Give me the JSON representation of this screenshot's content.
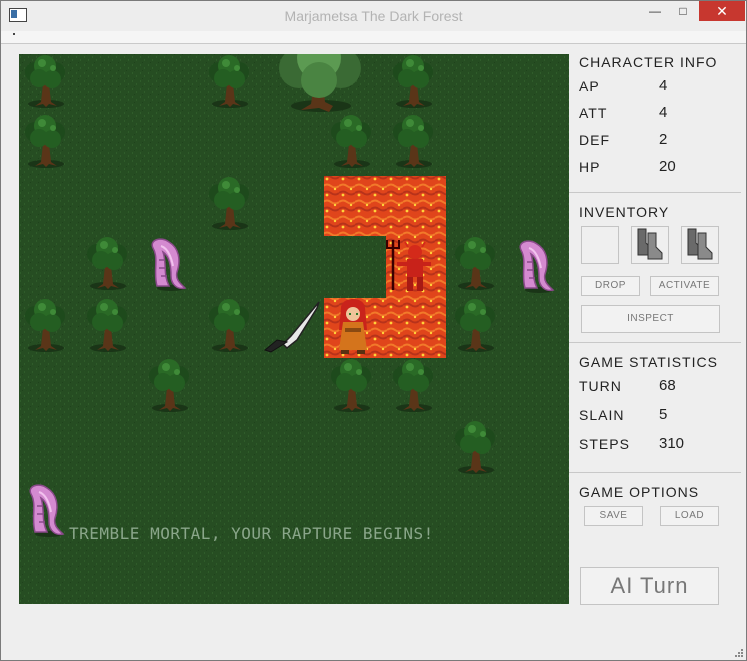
{
  "window": {
    "title": "Marjametsa The Dark Forest"
  },
  "board": {
    "message": "TREMBLE MORTAL, YOUR RAPTURE BEGINS!"
  },
  "character_info": {
    "title": "CHARACTER INFO",
    "stats": [
      {
        "key": "AP",
        "value": "4"
      },
      {
        "key": "ATT",
        "value": "4"
      },
      {
        "key": "DEF",
        "value": "2"
      },
      {
        "key": "HP",
        "value": "20"
      }
    ]
  },
  "inventory": {
    "title": "INVENTORY",
    "slots": [
      "empty",
      "boots-icon",
      "boots-icon"
    ],
    "drop_label": "DROP",
    "activate_label": "ACTIVATE",
    "inspect_label": "INSPECT"
  },
  "game_statistics": {
    "title": "GAME STATISTICS",
    "stats": [
      {
        "key": "TURN",
        "value": "68"
      },
      {
        "key": "SLAIN",
        "value": "5"
      },
      {
        "key": "STEPS",
        "value": "310"
      }
    ]
  },
  "game_options": {
    "title": "GAME OPTIONS",
    "save_label": "SAVE",
    "load_label": "LOAD"
  },
  "ai_turn_label": "AI Turn",
  "colors": {
    "grass": "#264d22",
    "lava": "#e0451b",
    "close_button": "#c7372f"
  }
}
